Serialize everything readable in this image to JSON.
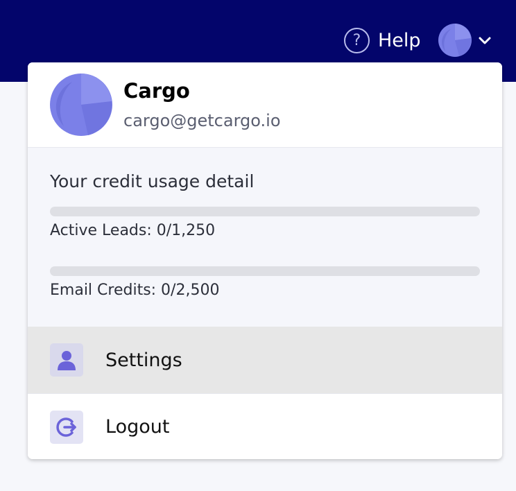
{
  "header": {
    "help_icon_glyph": "?",
    "help_label": "Help"
  },
  "user": {
    "name": "Cargo",
    "email": "cargo@getcargo.io"
  },
  "usage": {
    "title": "Your credit usage detail",
    "meters": [
      {
        "label": "Active Leads: 0/1,250",
        "used": 0,
        "total": 1250
      },
      {
        "label": "Email Credits: 0/2,500",
        "used": 0,
        "total": 2500
      }
    ]
  },
  "menu": {
    "settings_label": "Settings",
    "logout_label": "Logout"
  },
  "colors": {
    "topbar": "#03056b",
    "accent": "#6a6fe0",
    "avatar_base": "#7b80e8",
    "icon_purple": "#6b63d9"
  }
}
